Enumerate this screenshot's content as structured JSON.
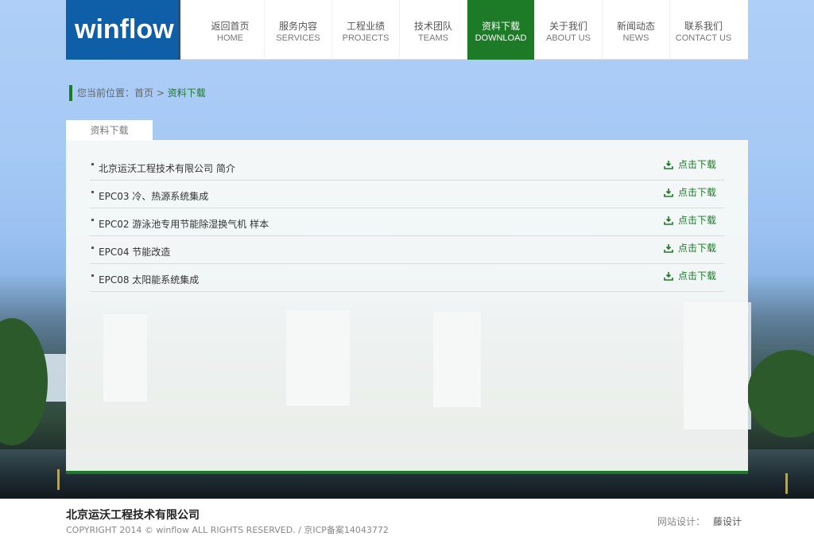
{
  "logo": {
    "text": "winflow"
  },
  "nav": [
    {
      "zh": "返回首页",
      "en": "HOME"
    },
    {
      "zh": "服务内容",
      "en": "SERVICES"
    },
    {
      "zh": "工程业绩",
      "en": "PROJECTS"
    },
    {
      "zh": "技术团队",
      "en": "TEAMS"
    },
    {
      "zh": "资料下载",
      "en": "DOWNLOAD",
      "active": true
    },
    {
      "zh": "关于我们",
      "en": "ABOUT US"
    },
    {
      "zh": "新闻动态",
      "en": "NEWS"
    },
    {
      "zh": "联系我们",
      "en": "CONTACT US"
    }
  ],
  "breadcrumb": {
    "prefix": "您当前位置：",
    "home": "首页",
    "sep": " > ",
    "current": "资料下载"
  },
  "tab": {
    "label": "资料下载"
  },
  "downloads": [
    {
      "name": "北京运沃工程技术有限公司 简介",
      "action": "点击下载"
    },
    {
      "name": "EPC03 冷、热源系统集成",
      "action": "点击下载"
    },
    {
      "name": "EPC02 游泳池专用节能除湿换气机 样本",
      "action": "点击下载"
    },
    {
      "name": "EPC04 节能改造",
      "action": "点击下载"
    },
    {
      "name": "EPC08 太阳能系统集成",
      "action": "点击下载"
    }
  ],
  "footer": {
    "company": "北京运沃工程技术有限公司",
    "copyright": "COPYRIGHT 2014 © winflow ALL RIGHTS RESERVED. / 京ICP备案14043772",
    "design_label": "网站设计：",
    "design_by": "藤设计"
  },
  "colors": {
    "accent": "#1d7a26",
    "logo_bg": "#0f5ea8"
  }
}
